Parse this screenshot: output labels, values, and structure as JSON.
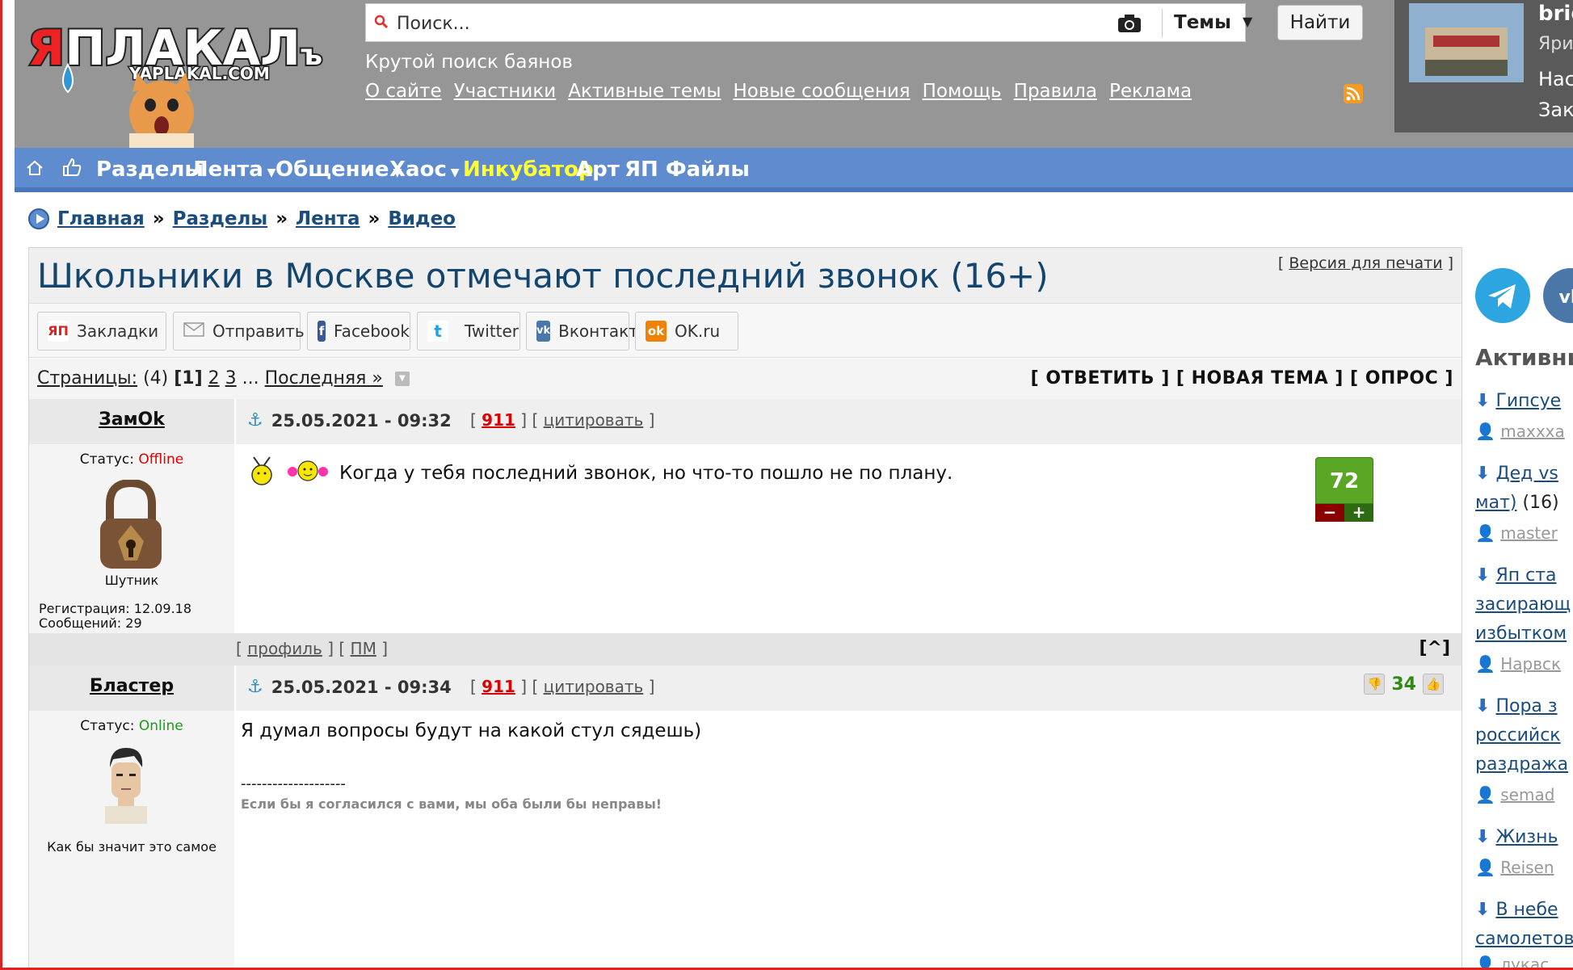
{
  "header": {
    "logo_text": "ЯПЛАКАЛЪ",
    "logo_domain": "YAPLAKAL.COM",
    "search_placeholder": "Поиск...",
    "search_scope": "Темы",
    "search_button": "Найти",
    "tagline": "Крутой поиск баянов",
    "links": [
      "О сайте",
      "Участники",
      "Активные темы",
      "Новые сообщения",
      "Помощь",
      "Правила",
      "Реклама"
    ],
    "user_panel": {
      "line1": "brigi",
      "line2": "Ярила",
      "line3": "Наст",
      "line4": "Закл"
    }
  },
  "nav": {
    "items": [
      "Разделы",
      "Лента",
      "Общение",
      "Хаос",
      "Инкубатор",
      "Арт",
      "ЯП Файлы"
    ]
  },
  "breadcrumb": [
    "Главная",
    "Разделы",
    "Лента",
    "Видео"
  ],
  "topic": {
    "title": "Школьники в Москве отмечают последний звонок (16+)",
    "print_link": "Версия для печати",
    "share": [
      "Закладки",
      "Отправить",
      "Facebook",
      "Twitter",
      "Вконтакте",
      "OK.ru"
    ],
    "pages_label": "Страницы:",
    "pages_count": "(4)",
    "current_page": "[1]",
    "page_links": [
      "2",
      "3"
    ],
    "last_page": "Последняя »",
    "actions": "[ ОТВЕТИТЬ ] [ НОВАЯ ТЕМА ] [ ОПРОС ]"
  },
  "posts": [
    {
      "author": "ЗамOk",
      "status_label": "Статус:",
      "status": "Offline",
      "rank": "Шутник",
      "registered": "Регистрация: 12.09.18",
      "messages": "Сообщений: 29",
      "date": "25.05.2021 - 09:32",
      "report_num": "911",
      "quote": "цитировать",
      "text": "Когда у тебя последний звонок, но что-то пошло не по плану.",
      "rating": "72",
      "footer_links": [
        "профиль",
        "ПМ"
      ],
      "up": "[^]"
    },
    {
      "author": "Бластер",
      "status_label": "Статус:",
      "status": "Online",
      "rank": "Как бы значит это самое",
      "date": "25.05.2021 - 09:34",
      "report_num": "911",
      "quote": "цитировать",
      "text": "Я думал вопросы будут на какой стул сядешь)",
      "signature_line": "--------------------",
      "signature": "Если бы я согласился с вами, мы оба были бы неправы!",
      "rating": "34"
    }
  ],
  "sidebar": {
    "title": "Активны",
    "items": [
      {
        "title": "Гипсуе",
        "user": "maxxxa"
      },
      {
        "title": "Дед vs",
        "title2": "мат)",
        "count": "(16)",
        "user": "master"
      },
      {
        "title": "Яп ста",
        "title2": "засирающ",
        "title3": "избытком",
        "user": "Нарвск"
      },
      {
        "title": "Пора з",
        "title2": "российск",
        "title3": "раздража",
        "user": "semad"
      },
      {
        "title": "Жизнь",
        "user": "Reisen"
      },
      {
        "title": "В небе",
        "title2": "самолетов",
        "user": "лукас"
      }
    ]
  },
  "colors": {
    "nav_bg": "#5e8ccf",
    "header_bg": "#969696",
    "title": "#13456f",
    "rating_green": "#5aa625",
    "offline": "#dd0000",
    "online": "#1a9a1a"
  }
}
